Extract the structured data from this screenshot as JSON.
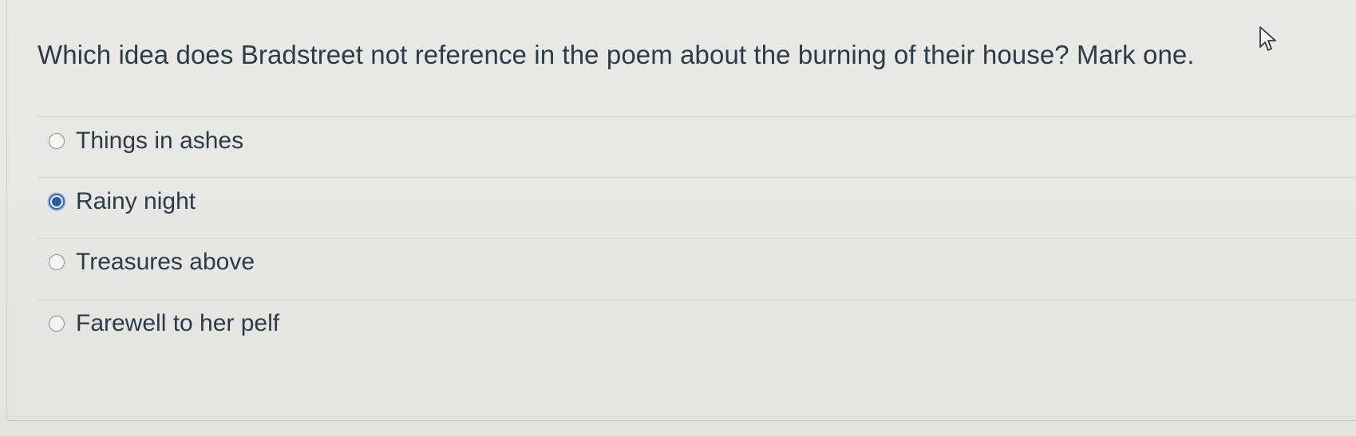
{
  "question": {
    "text": "Which idea does Bradstreet not reference in the poem about the burning of their house? Mark one."
  },
  "answers": [
    {
      "label": "Things in ashes",
      "selected": false
    },
    {
      "label": "Rainy night",
      "selected": true
    },
    {
      "label": "Treasures above",
      "selected": false
    },
    {
      "label": "Farewell to her pelf",
      "selected": false
    }
  ],
  "colors": {
    "selected_radio": "#1f5fa8",
    "text": "#2d3b45",
    "background": "#e7e7e5"
  },
  "icons": {
    "pointer": "mouse-pointer-icon"
  }
}
